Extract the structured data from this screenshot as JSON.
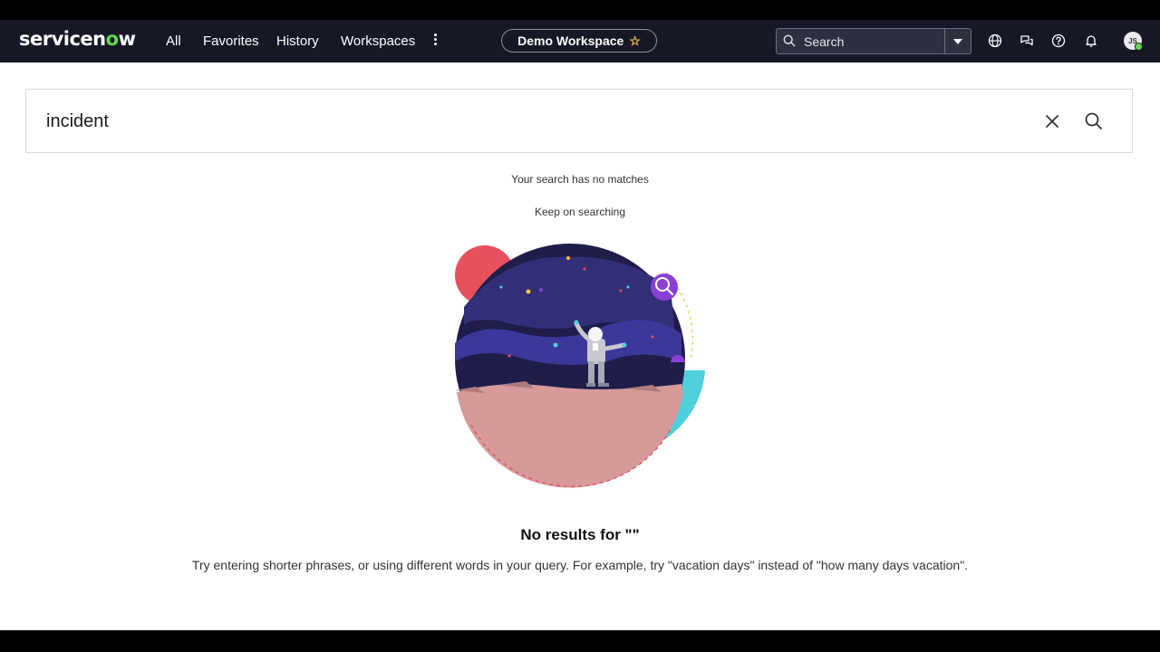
{
  "nav": {
    "logo_prefix": "servicen",
    "logo_o": "o",
    "logo_suffix": "w",
    "menu": [
      "All",
      "Favorites",
      "History",
      "Workspaces"
    ],
    "workspace_label": "Demo Workspace",
    "search_placeholder": "Search",
    "avatar_initials": "JS",
    "icons": [
      "more-vertical-icon",
      "star-icon",
      "search-icon",
      "chevron-down-icon",
      "globe-icon",
      "chat-icon",
      "help-icon",
      "bell-icon"
    ]
  },
  "search": {
    "query": "incident"
  },
  "results": {
    "no_match": "Your search has no matches",
    "keep": "Keep on searching",
    "no_results_title": "No results for \"\"",
    "hint": "Try entering shorter phrases, or using different words in your query. For example, try \"vacation days\" instead of \"how many days vacation\"."
  },
  "colors": {
    "nav_bg": "#171826",
    "brand_green": "#62d84e",
    "accent_purple": "#8a3fd6"
  }
}
